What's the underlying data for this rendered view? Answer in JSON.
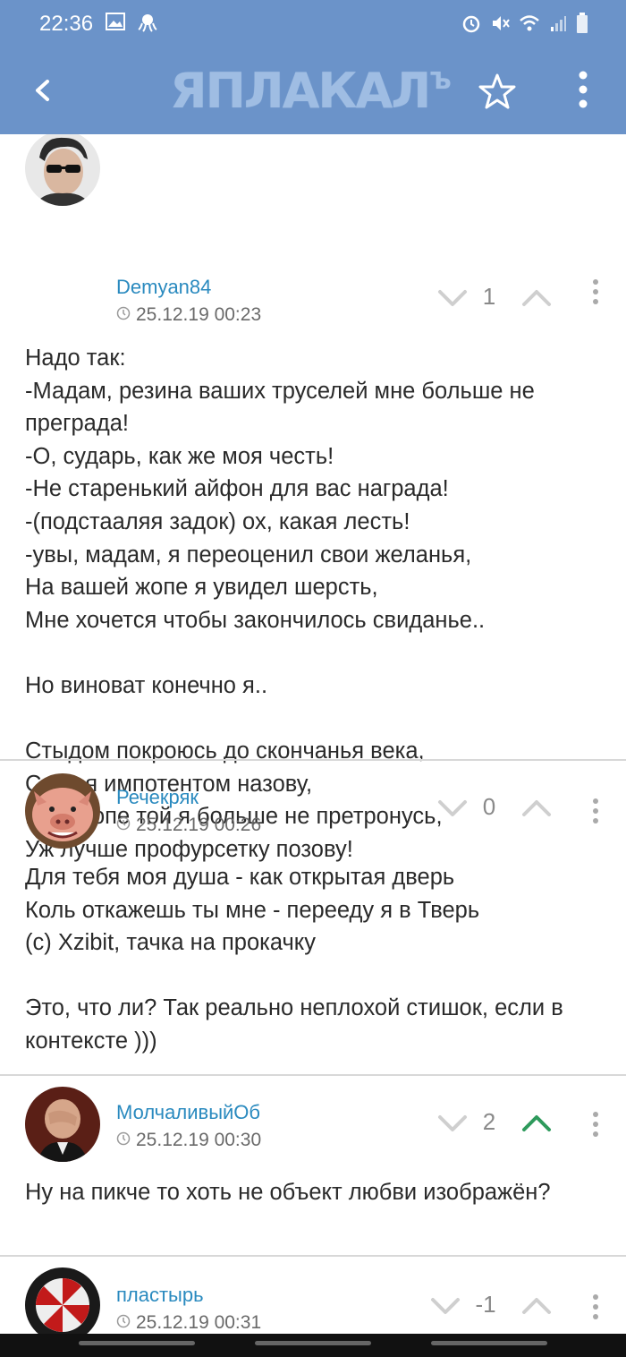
{
  "status": {
    "time": "22:36"
  },
  "header": {
    "logo": "ЯПЛАКАЛ",
    "logo_sup": "Ъ"
  },
  "comments": [
    {
      "author": "Demyan84",
      "date": "25.12.19 00:23",
      "score": "1",
      "upvoted": false,
      "text": "Надо так:\n-Мадам, резина ваших труселей мне больше не преграда!\n-О, сударь, как же моя честь!\n-Не старенький айфон для вас награда!\n-(подстааляя задок) ох, какая лесть!\n-увы, мадам, я переоценил свои желанья,\nНа вашей жопе я увидел шерсть,\nМне хочется чтобы закончилось свиданье..\n\nНо виноват конечно я..\n\nСтыдом покроюсь до сконча​нья века,\nСебя я импотентом назову,\nНо к жопе той я больше не претронусь,\nУж лучше профурсетку позову!"
    },
    {
      "author": "Речекряк",
      "date": "25.12.19 00:26",
      "score": "0",
      "upvoted": false,
      "text": "Для тебя моя душа - как открытая дверь\nКоль откажешь ты мне - перееду я в Тверь\n(с) Xzibit, тачка на прокачку\n\nЭто, что ли? Так реально неплохой стишок, если в контексте )))"
    },
    {
      "author": "МолчаливыйОб",
      "date": "25.12.19 00:30",
      "score": "2",
      "upvoted": true,
      "text": "Ну на пикче то хоть не объект любви изображён?"
    },
    {
      "author": "пластырь",
      "date": "25.12.19 00:31",
      "score": "-1",
      "upvoted": false,
      "text": ""
    }
  ],
  "colors": {
    "appbar": "#6b93c9",
    "author": "#2a8abf",
    "upvote_active": "#2e9a5c",
    "vote_inactive": "#cfcfcf"
  }
}
